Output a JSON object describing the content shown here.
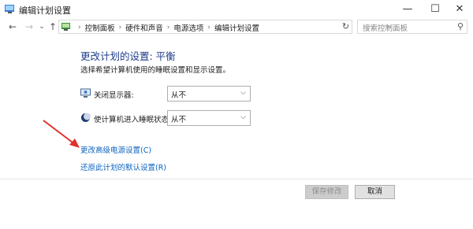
{
  "window": {
    "title": "编辑计划设置",
    "minimize": "—",
    "maximize": "☐",
    "close": "✕"
  },
  "nav": {
    "back": "←",
    "forward": "→",
    "recent": "⌄",
    "up": "↑",
    "breadcrumbs": [
      "控制面板",
      "硬件和声音",
      "电源选项",
      "编辑计划设置"
    ],
    "refresh": "↻",
    "search_placeholder": "搜索控制面板"
  },
  "main": {
    "heading": "更改计划的设置: 平衡",
    "subtitle": "选择希望计算机使用的睡眠设置和显示设置。",
    "settings": [
      {
        "label": "关闭显示器:",
        "value": "从不",
        "icon": "monitor-icon"
      },
      {
        "label": "使计算机进入睡眠状态:",
        "value": "从不",
        "icon": "moon-icon"
      }
    ],
    "links": {
      "advanced": "更改高级电源设置(C)",
      "restore": "还原此计划的默认设置(R)"
    }
  },
  "footer": {
    "save_label": "保存修改",
    "cancel_label": "取消"
  },
  "colors": {
    "heading": "#1e3c8a",
    "link": "#0b63c1",
    "annotation_arrow": "#e0312b"
  }
}
